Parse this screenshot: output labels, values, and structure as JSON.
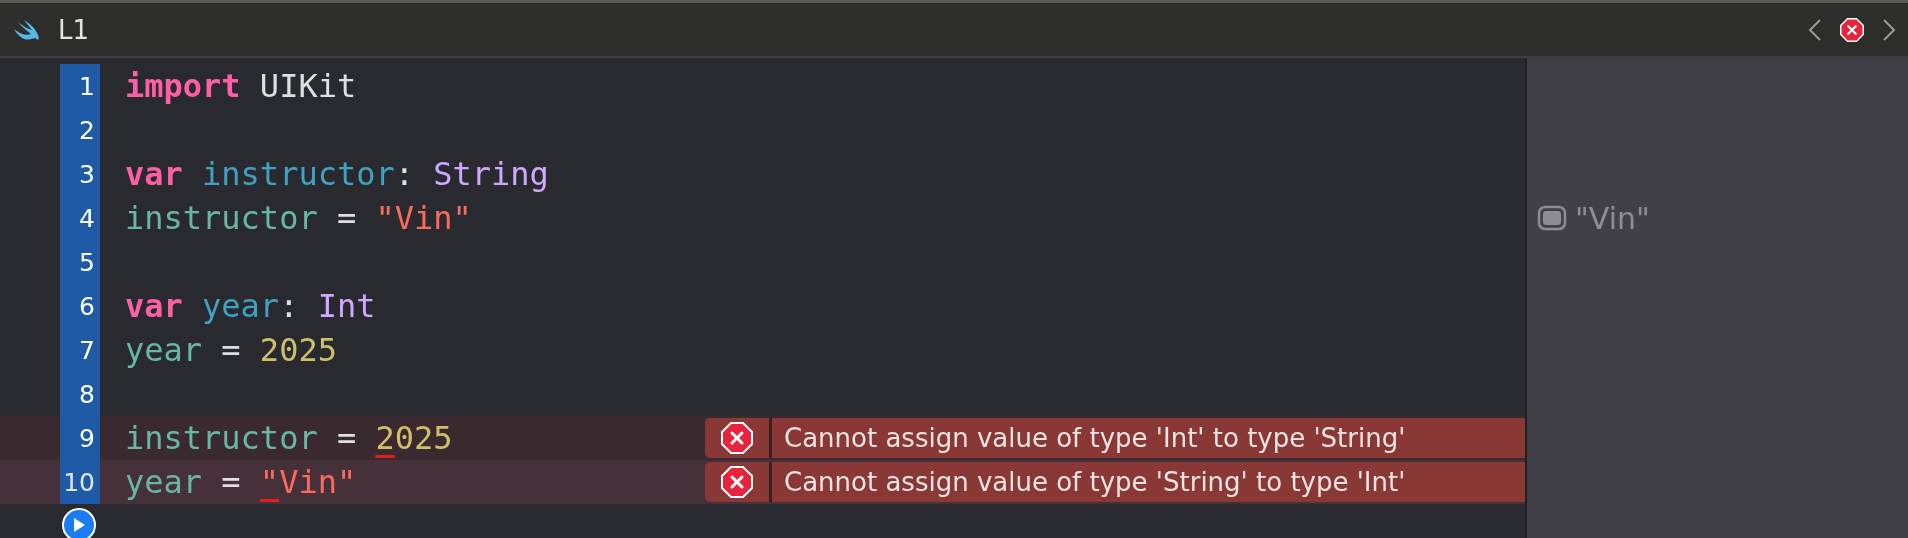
{
  "title_bar": {
    "label": "L1"
  },
  "lines": [
    {
      "number": "1",
      "error": false,
      "current": false,
      "tokens": [
        {
          "text": "import",
          "kind": "keyword"
        },
        {
          "text": " UIKit",
          "kind": "plain"
        }
      ]
    },
    {
      "number": "2",
      "error": false,
      "current": false
    },
    {
      "number": "3",
      "error": false,
      "current": false,
      "tokens": [
        {
          "text": "var",
          "kind": "keyword"
        },
        {
          "text": " instructor",
          "kind": "decl"
        },
        {
          "text": ": ",
          "kind": "plain"
        },
        {
          "text": "String",
          "kind": "type"
        }
      ]
    },
    {
      "number": "4",
      "error": false,
      "current": false,
      "result": "\"Vin\"",
      "tokens": [
        {
          "text": "instructor",
          "kind": "variable"
        },
        {
          "text": " = ",
          "kind": "plain"
        },
        {
          "text": "\"Vin\"",
          "kind": "string"
        }
      ]
    },
    {
      "number": "5",
      "error": false,
      "current": false
    },
    {
      "number": "6",
      "error": false,
      "current": false,
      "tokens": [
        {
          "text": "var",
          "kind": "keyword"
        },
        {
          "text": " year",
          "kind": "decl"
        },
        {
          "text": ": ",
          "kind": "plain"
        },
        {
          "text": "Int",
          "kind": "type"
        }
      ]
    },
    {
      "number": "7",
      "error": false,
      "current": false,
      "tokens": [
        {
          "text": "year",
          "kind": "variable"
        },
        {
          "text": " = ",
          "kind": "plain"
        },
        {
          "text": "2025",
          "kind": "number"
        }
      ]
    },
    {
      "number": "8",
      "error": false,
      "current": false
    },
    {
      "number": "9",
      "error": true,
      "current": false,
      "message": "Cannot assign value of type 'Int' to type 'String'",
      "tokens": [
        {
          "text": "instructor",
          "kind": "variable"
        },
        {
          "text": " = ",
          "kind": "plain"
        },
        {
          "text": "2",
          "kind": "number",
          "underlined": true
        },
        {
          "text": "025",
          "kind": "number"
        }
      ]
    },
    {
      "number": "10",
      "error": true,
      "current": true,
      "message": "Cannot assign value of type 'String' to type 'Int'",
      "tokens": [
        {
          "text": "year",
          "kind": "variable"
        },
        {
          "text": " = ",
          "kind": "plain"
        },
        {
          "text": "\"",
          "kind": "string",
          "underlined": true
        },
        {
          "text": "Vin\"",
          "kind": "string"
        }
      ]
    }
  ]
}
